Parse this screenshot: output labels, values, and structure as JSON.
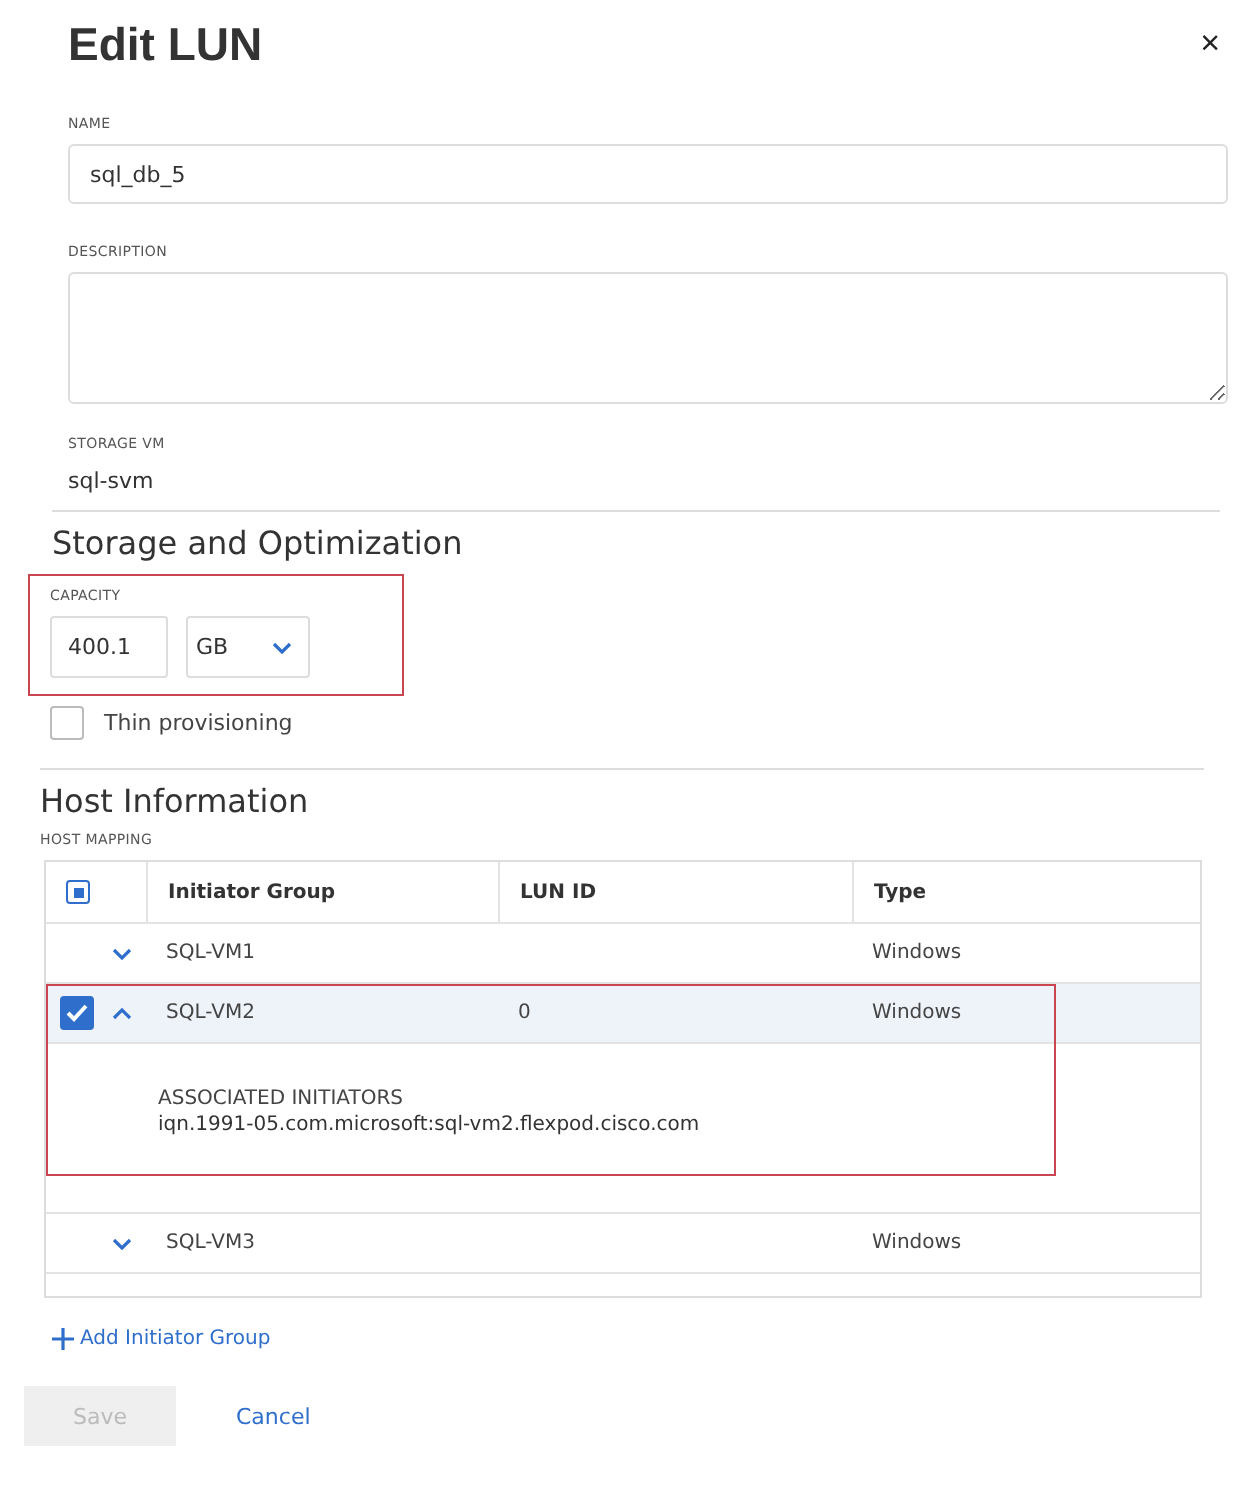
{
  "dialog": {
    "title": "Edit LUN",
    "close": "×"
  },
  "name": {
    "label": "NAME",
    "value": "sql_db_5"
  },
  "description": {
    "label": "DESCRIPTION"
  },
  "storage_vm": {
    "label": "STORAGE VM",
    "value": "sql-svm"
  },
  "storage_section": {
    "heading": "Storage and Optimization",
    "capacity": {
      "label": "CAPACITY",
      "value": "400.1",
      "unit": "GB",
      "highlighted": true
    },
    "thin_provisioning": {
      "label": "Thin provisioning",
      "checked": false
    }
  },
  "host_section": {
    "heading": "Host Information",
    "mapping_label": "HOST MAPPING",
    "table": {
      "header_checkbox": {
        "partial": true
      },
      "columns": [
        "Initiator Group",
        "LUN ID",
        "Type"
      ],
      "rows": [
        {
          "initiator_group": "SQL-VM1",
          "lun_id": "",
          "type": "Windows",
          "checked": false,
          "expanded": false,
          "highlighted": false
        },
        {
          "initiator_group": "SQL-VM2",
          "lun_id": "0",
          "type": "Windows",
          "checked": true,
          "expanded": true,
          "highlighted": true,
          "details": {
            "label": "ASSOCIATED INITIATORS",
            "value": "iqn.1991-05.com.microsoft:sql-vm2.flexpod.cisco.com"
          }
        },
        {
          "initiator_group": "SQL-VM3",
          "lun_id": "",
          "type": "Windows",
          "checked": false,
          "expanded": false,
          "highlighted": false
        }
      ]
    },
    "add_link": "Add Initiator Group"
  },
  "buttons": {
    "save": {
      "label": "Save",
      "disabled": true
    },
    "cancel": {
      "label": "Cancel"
    }
  }
}
